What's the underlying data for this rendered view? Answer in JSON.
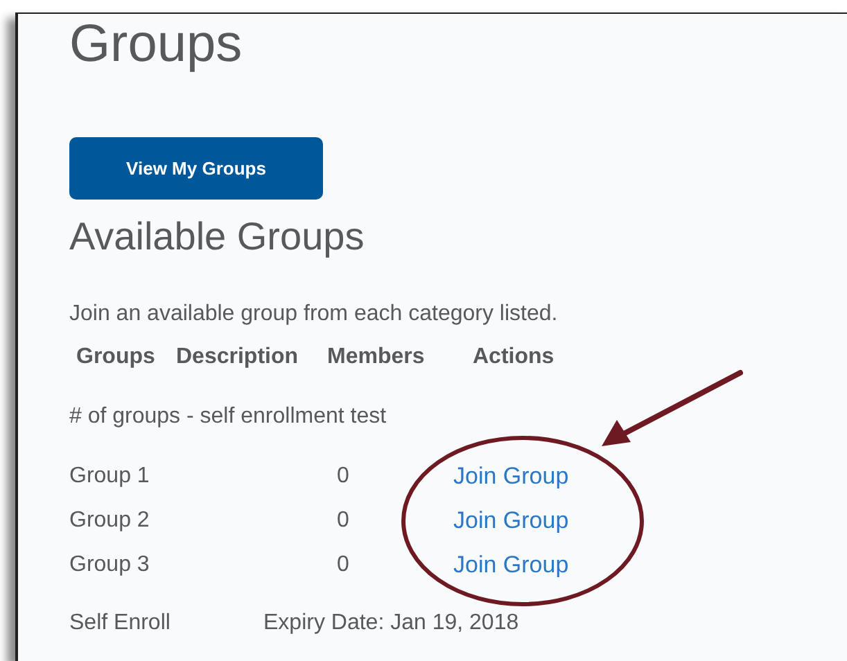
{
  "page": {
    "title": "Groups",
    "view_button": "View My Groups",
    "section_title": "Available Groups",
    "instructions": "Join an available group from each category listed."
  },
  "table": {
    "columns": [
      "Groups",
      "Description",
      "Members",
      "Actions"
    ],
    "category": "# of groups - self enrollment test",
    "rows": [
      {
        "name": "Group 1",
        "members": "0",
        "action": "Join Group"
      },
      {
        "name": "Group 2",
        "members": "0",
        "action": "Join Group"
      },
      {
        "name": "Group 3",
        "members": "0",
        "action": "Join Group"
      }
    ],
    "footer": {
      "type": "Self Enroll",
      "expiry": "Expiry Date: Jan 19, 2018"
    }
  }
}
